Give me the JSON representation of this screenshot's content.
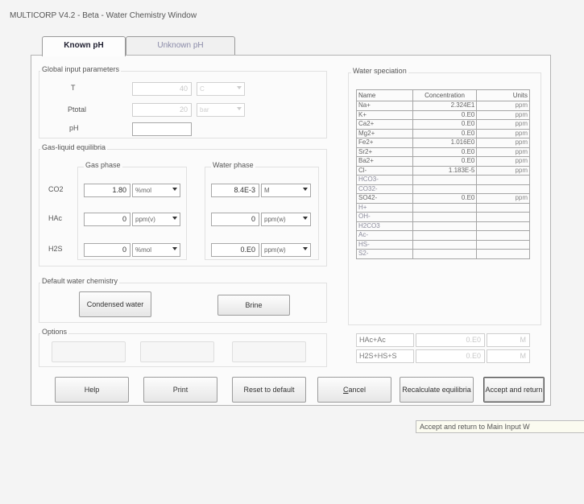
{
  "window": {
    "title": "MULTICORP V4.2 - Beta - Water Chemistry Window"
  },
  "tabs": [
    {
      "label": "Known pH",
      "active": true
    },
    {
      "label": "Unknown pH",
      "active": false
    }
  ],
  "global": {
    "title": "Global input parameters",
    "t_label": "T",
    "t_value": "40",
    "t_unit": "C",
    "ptotal_label": "Ptotal",
    "ptotal_value": "20",
    "ptotal_unit": "bar",
    "ph_label": "pH",
    "ph_value": ""
  },
  "gas_liquid": {
    "title": "Gas-liquid equilibria",
    "gas_phase_label": "Gas phase",
    "water_phase_label": "Water phase",
    "rows": [
      {
        "name": "CO2",
        "gas_value": "1.80",
        "gas_unit": "%mol",
        "water_value": "8.4E-3",
        "water_unit": "M"
      },
      {
        "name": "HAc",
        "gas_value": "0",
        "gas_unit": "ppm(v)",
        "water_value": "0",
        "water_unit": "ppm(w)"
      },
      {
        "name": "H2S",
        "gas_value": "0",
        "gas_unit": "%mol",
        "water_value": "0.E0",
        "water_unit": "ppm(w)"
      }
    ]
  },
  "default_water": {
    "title": "Default water chemistry",
    "condensed_label": "Condensed water",
    "brine_label": "Brine"
  },
  "options": {
    "title": "Options",
    "buttons": [
      "",
      "",
      ""
    ]
  },
  "speciation": {
    "title": "Water speciation",
    "headers": [
      "Name",
      "Concentration",
      "Units"
    ],
    "rows": [
      {
        "name": "Na+",
        "conc": "2.324E1",
        "unit": "ppm",
        "faint": false
      },
      {
        "name": "K+",
        "conc": "0.E0",
        "unit": "ppm",
        "faint": false
      },
      {
        "name": "Ca2+",
        "conc": "0.E0",
        "unit": "ppm",
        "faint": false
      },
      {
        "name": "Mg2+",
        "conc": "0.E0",
        "unit": "ppm",
        "faint": false
      },
      {
        "name": "Fe2+",
        "conc": "1.016E0",
        "unit": "ppm",
        "faint": false
      },
      {
        "name": "Sr2+",
        "conc": "0.E0",
        "unit": "ppm",
        "faint": false
      },
      {
        "name": "Ba2+",
        "conc": "0.E0",
        "unit": "ppm",
        "faint": false
      },
      {
        "name": "Cl-",
        "conc": "1.183E-5",
        "unit": "ppm",
        "faint": false
      },
      {
        "name": "HCO3-",
        "conc": "",
        "unit": "",
        "faint": true
      },
      {
        "name": "CO32-",
        "conc": "",
        "unit": "",
        "faint": true
      },
      {
        "name": "SO42-",
        "conc": "0.E0",
        "unit": "ppm",
        "faint": false
      },
      {
        "name": "H+",
        "conc": "",
        "unit": "",
        "faint": true
      },
      {
        "name": "OH-",
        "conc": "",
        "unit": "",
        "faint": true
      },
      {
        "name": "H2CO3",
        "conc": "",
        "unit": "",
        "faint": true
      },
      {
        "name": "Ac-",
        "conc": "",
        "unit": "",
        "faint": true
      },
      {
        "name": "HS-",
        "conc": "",
        "unit": "",
        "faint": true
      },
      {
        "name": "S2-",
        "conc": "",
        "unit": "",
        "faint": true
      }
    ],
    "hac_label": "HAc+Ac",
    "hac_value": "0.E0",
    "hac_unit": "M",
    "h2s_label": "H2S+HS+S",
    "h2s_value": "0.E0",
    "h2s_unit": "M"
  },
  "buttons": {
    "help": "Help",
    "print": "Print",
    "reset": "Reset to default",
    "cancel_first": "C",
    "cancel_rest": "ancel",
    "recalc": "Recalculate equilibria",
    "accept": "Accept and return"
  },
  "tooltip": "Accept and return to Main Input W"
}
